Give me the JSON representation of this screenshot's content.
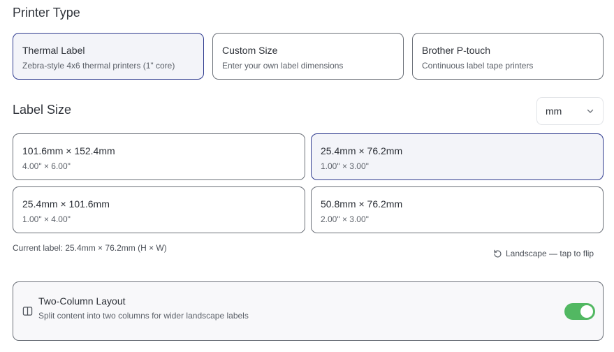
{
  "printer_type": {
    "heading": "Printer Type",
    "options": [
      {
        "title": "Thermal Label",
        "subtitle": "Zebra-style 4x6 thermal printers (1\" core)",
        "selected": true
      },
      {
        "title": "Custom Size",
        "subtitle": "Enter your own label dimensions",
        "selected": false
      },
      {
        "title": "Brother P-touch",
        "subtitle": "Continuous label tape printers",
        "selected": false
      }
    ]
  },
  "label_size": {
    "heading": "Label Size",
    "unit_select": {
      "value": "mm"
    },
    "options": [
      {
        "title": "101.6mm × 152.4mm",
        "subtitle": "4.00\" × 6.00\"",
        "selected": false
      },
      {
        "title": "25.4mm × 76.2mm",
        "subtitle": "1.00\" × 3.00\"",
        "selected": true
      },
      {
        "title": "25.4mm × 101.6mm",
        "subtitle": "1.00\" × 4.00\"",
        "selected": false
      },
      {
        "title": "50.8mm × 76.2mm",
        "subtitle": "2.00\" × 3.00\"",
        "selected": false
      }
    ],
    "current_label": "Current label: 25.4mm × 76.2mm (H × W)",
    "orientation_toggle": "Landscape — tap to flip"
  },
  "two_column": {
    "title": "Two-Column Layout",
    "subtitle": "Split content into two columns for wider landscape labels",
    "enabled": true
  },
  "colors": {
    "selected_border": "#2f3b8f",
    "selected_bg": "#f3f4f9",
    "toggle_on": "#52b862"
  },
  "icons": {
    "flip": "rotate-ccw-icon",
    "panel": "columns-icon",
    "select": "chevron-down-icon"
  }
}
